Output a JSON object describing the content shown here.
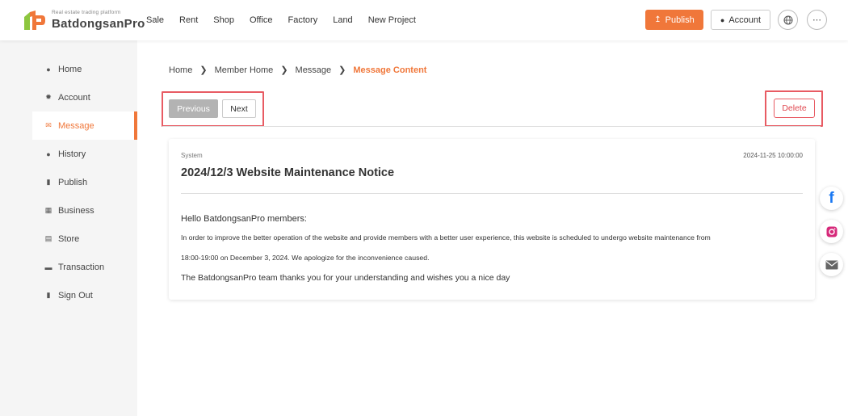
{
  "brand": {
    "tagline": "Real estate trading platform",
    "name": "BatdongsanPro"
  },
  "nav": [
    "Sale",
    "Rent",
    "Shop",
    "Office",
    "Factory",
    "Land",
    "New Project"
  ],
  "header": {
    "publish_label": "Publish",
    "account_label": "Account",
    "globe_icon": "globe-icon",
    "more_icon": "more-icon"
  },
  "sidebar": {
    "items": [
      {
        "label": "Home",
        "icon": "person-icon"
      },
      {
        "label": "Account",
        "icon": "gear-icon"
      },
      {
        "label": "Message",
        "icon": "envelope-icon"
      },
      {
        "label": "History",
        "icon": "clock-icon"
      },
      {
        "label": "Publish",
        "icon": "publish-icon"
      },
      {
        "label": "Business",
        "icon": "building-icon"
      },
      {
        "label": "Store",
        "icon": "store-icon"
      },
      {
        "label": "Transaction",
        "icon": "wallet-icon"
      },
      {
        "label": "Sign Out",
        "icon": "signout-icon"
      }
    ],
    "active_index": 2
  },
  "breadcrumb": [
    "Home",
    "Member Home",
    "Message",
    "Message Content"
  ],
  "actions": {
    "previous_label": "Previous",
    "next_label": "Next",
    "delete_label": "Delete"
  },
  "message": {
    "source": "System",
    "date": "2024-11-25 10:00:00",
    "title": "2024/12/3 Website Maintenance Notice",
    "greeting": "Hello BatdongsanPro members:",
    "body_line1": "In order to improve the better operation of the website and provide members with a better user experience, this website is scheduled to undergo website maintenance from",
    "body_line2": "18:00-19:00 on December 3, 2024. We apologize for the inconvenience caused.",
    "closing": "The BatdongsanPro team thanks you for your understanding and wishes you a nice day"
  },
  "colors": {
    "accent": "#f0773a",
    "highlight": "#e85b63",
    "facebook": "#1877f2",
    "instagram": "#d6297a"
  }
}
